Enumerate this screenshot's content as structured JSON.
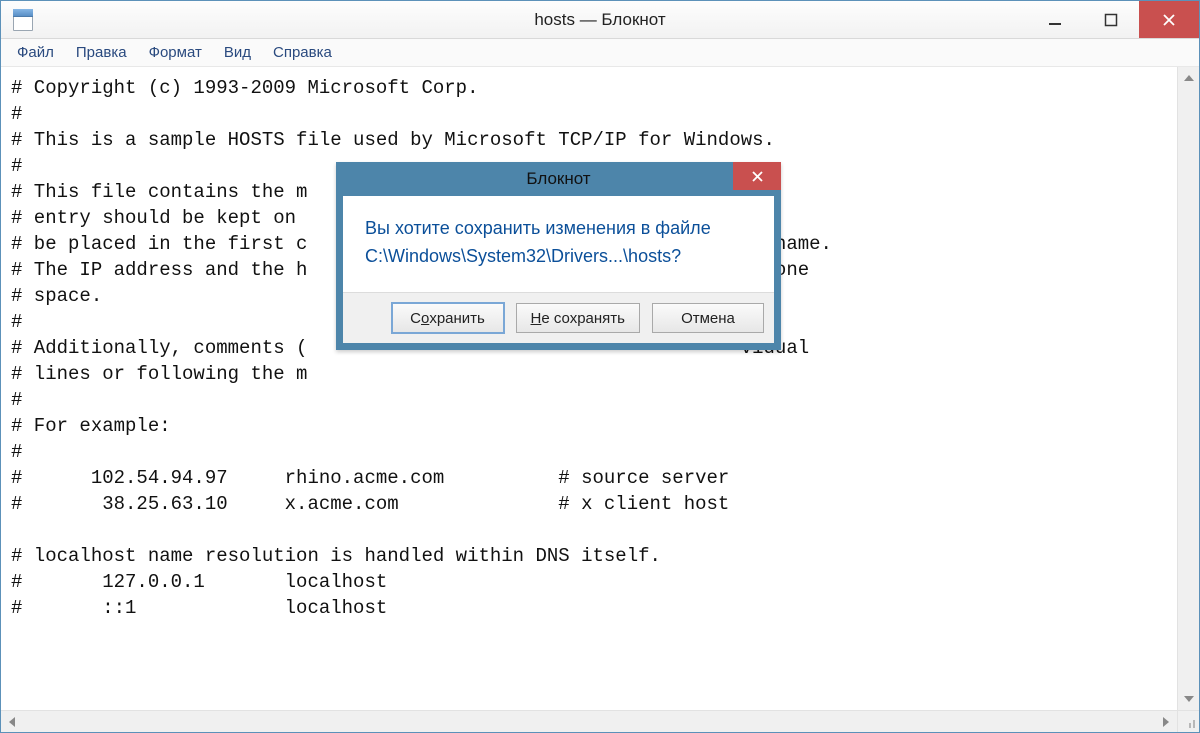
{
  "window": {
    "title": "hosts — Блокнот"
  },
  "menubar": {
    "file": "Файл",
    "edit": "Правка",
    "format": "Формат",
    "view": "Вид",
    "help": "Справка"
  },
  "editor": {
    "text": "# Copyright (c) 1993-2009 Microsoft Corp.\n#\n# This is a sample HOSTS file used by Microsoft TCP/IP for Windows.\n#\n# This file contains the m                                     Each\n# entry should be kept on                                       uld\n# be placed in the first c                                      st name.\n# The IP address and the h                                      st one\n# space.\n#\n# Additionally, comments (                                      vidual\n# lines or following the m\n#\n# For example:\n#\n#      102.54.94.97     rhino.acme.com          # source server\n#       38.25.63.10     x.acme.com              # x client host\n\n# localhost name resolution is handled within DNS itself.\n#       127.0.0.1       localhost\n#       ::1             localhost"
  },
  "dialog": {
    "title": "Блокнот",
    "message_line1": "Вы хотите сохранить изменения в файле",
    "message_line2": "C:\\Windows\\System32\\Drivers...\\hosts?",
    "save_prefix": "С",
    "save_ul": "о",
    "save_suffix": "хранить",
    "dont_prefix": "",
    "dont_ul": "Н",
    "dont_suffix": "е сохранять",
    "cancel": "Отмена"
  }
}
